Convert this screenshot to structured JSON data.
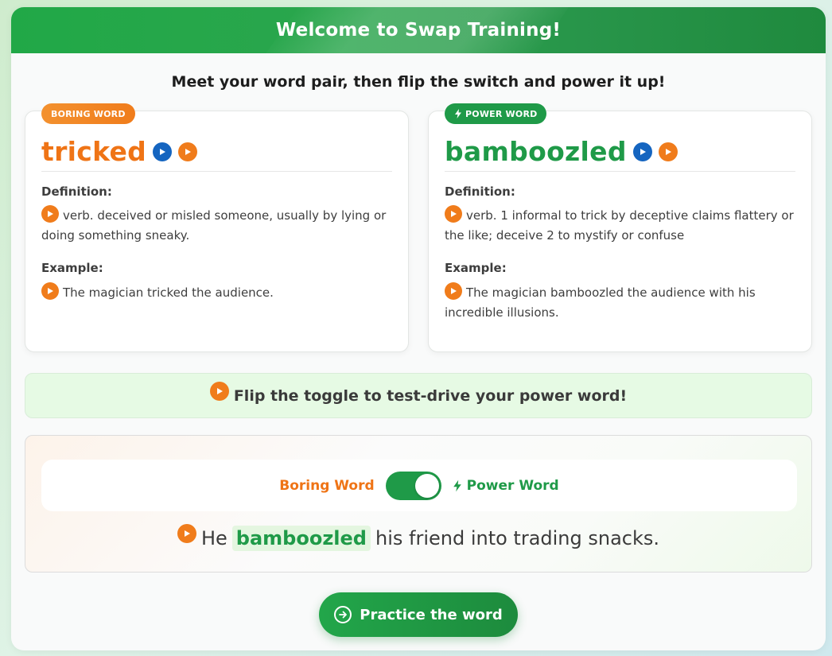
{
  "header": {
    "title": "Welcome to Swap Training!"
  },
  "subtitle": "Meet your word pair, then flip the switch and power it up!",
  "boring_card": {
    "badge": "BORING WORD",
    "word": "tricked",
    "definition_label": "Definition:",
    "definition": "verb. deceived or misled someone, usually by lying or doing something sneaky.",
    "example_label": "Example:",
    "example": "The magician tricked the audience."
  },
  "power_card": {
    "badge": "POWER WORD",
    "word": "bamboozled",
    "definition_label": "Definition:",
    "definition": "verb. 1 informal to trick by deceptive claims flattery or the like; deceive 2 to mystify or confuse",
    "example_label": "Example:",
    "example": "The magician bamboozled the audience with his incredible illusions."
  },
  "hint": {
    "text": "Flip the toggle to test-drive your power word!"
  },
  "toggle": {
    "left_label": "Boring Word",
    "right_label": "Power Word",
    "state": "power"
  },
  "sentence": {
    "before": "He",
    "highlight": "bamboozled",
    "after": "his friend into trading snacks."
  },
  "practice_button": {
    "label": "Practice the word"
  },
  "colors": {
    "green": "#1f9a48",
    "orange": "#ef7416",
    "blue": "#1565c0"
  },
  "icons": [
    "play-icon",
    "audio-play-icon",
    "lightning-icon",
    "arrow-right-circle-icon"
  ]
}
